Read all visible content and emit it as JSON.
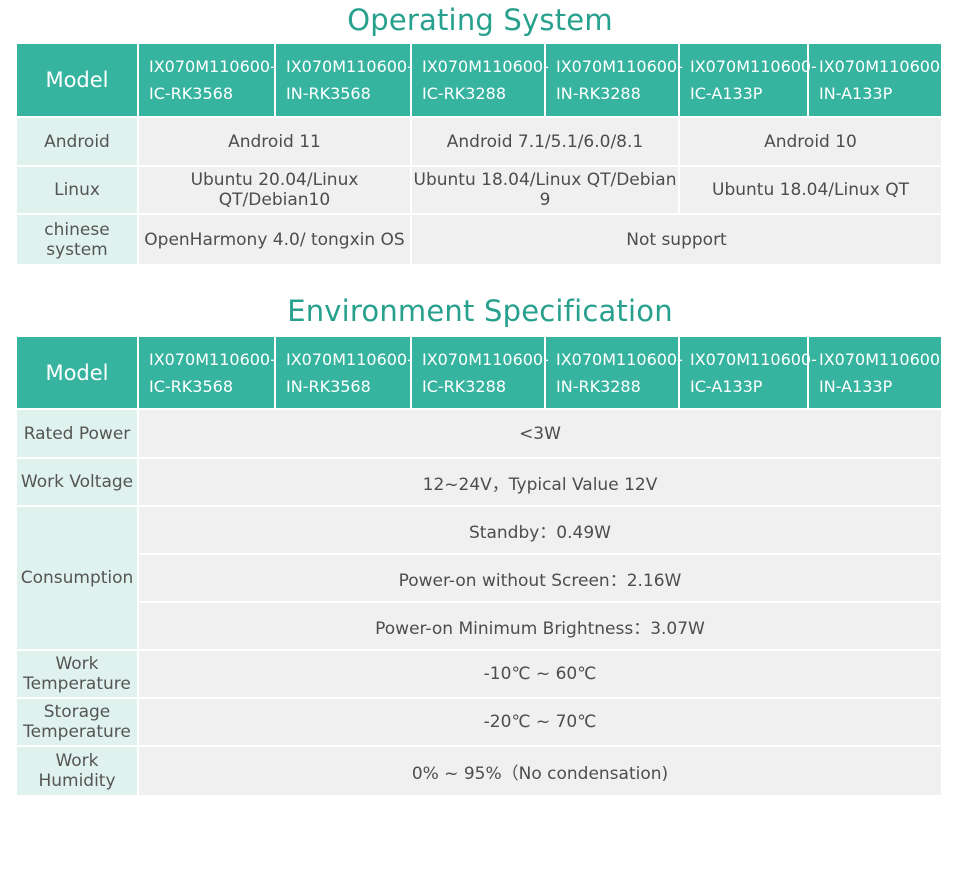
{
  "os_section": {
    "title": "Operating System",
    "header_label": "Model",
    "models": [
      {
        "line1": "IX070M110600-",
        "line2": "IC-RK3568"
      },
      {
        "line1": "IX070M110600-",
        "line2": "IN-RK3568"
      },
      {
        "line1": "IX070M110600-",
        "line2": "IC-RK3288"
      },
      {
        "line1": "IX070M110600-",
        "line2": "IN-RK3288"
      },
      {
        "line1": "IX070M110600-",
        "line2": "IC-A133P"
      },
      {
        "line1": "IX070M110600-",
        "line2": "IN-A133P"
      }
    ],
    "rows": {
      "android": {
        "label": "Android",
        "rk3568": "Android 11",
        "rk3288": "Android 7.1/5.1/6.0/8.1",
        "a133p": "Android 10"
      },
      "linux": {
        "label": "Linux",
        "rk3568": "Ubuntu 20.04/Linux QT/Debian10",
        "rk3288": "Ubuntu 18.04/Linux QT/Debian 9",
        "a133p": "Ubuntu 18.04/Linux QT"
      },
      "chinese": {
        "label_line1": "chinese",
        "label_line2": "system",
        "rk3568": "OpenHarmony 4.0/ tongxin OS",
        "others": "Not support"
      }
    }
  },
  "env_section": {
    "title": "Environment Specification",
    "header_label": "Model",
    "models": [
      {
        "line1": "IX070M110600-",
        "line2": "IC-RK3568"
      },
      {
        "line1": "IX070M110600-",
        "line2": "IN-RK3568"
      },
      {
        "line1": "IX070M110600-",
        "line2": "IC-RK3288"
      },
      {
        "line1": "IX070M110600-",
        "line2": "IN-RK3288"
      },
      {
        "line1": "IX070M110600-",
        "line2": "IC-A133P"
      },
      {
        "line1": "IX070M110600-",
        "line2": "IN-A133P"
      }
    ],
    "rated_power": {
      "label": "Rated Power",
      "value": "<3W"
    },
    "work_voltage": {
      "label": "Work Voltage",
      "value": "12~24V，Typical Value  12V"
    },
    "consumption": {
      "label": "Consumption",
      "standby": "Standby：0.49W",
      "power_on_no_screen": "Power-on without Screen：2.16W",
      "power_on_min_brightness": "Power-on Minimum Brightness：3.07W"
    },
    "work_temperature": {
      "label_line1": "Work",
      "label_line2": "Temperature",
      "value": "-10℃ ~ 60℃"
    },
    "storage_temperature": {
      "label_line1": "Storage",
      "label_line2": "Temperature",
      "value": "-20℃ ~ 70℃"
    },
    "work_humidity": {
      "label_line1": "Work",
      "label_line2": "Humidity",
      "value": "0% ~ 95%（No condensation)"
    }
  },
  "colors": {
    "accent": "#36b49f",
    "title": "#27a08d",
    "label_bg": "#dff2ee",
    "value_bg": "#f0f0f0"
  }
}
